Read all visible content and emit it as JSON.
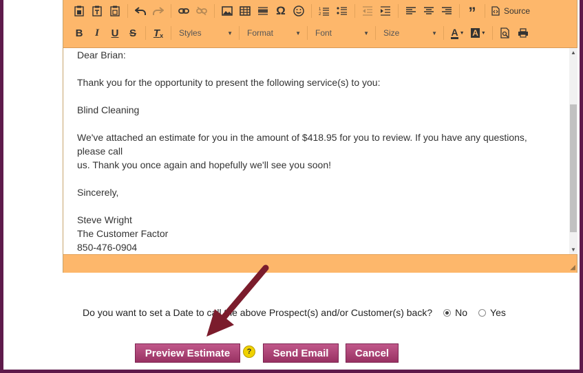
{
  "toolbar": {
    "source_label": "Source",
    "styles_label": "Styles",
    "format_label": "Format",
    "font_label": "Font",
    "size_label": "Size"
  },
  "editor_body": {
    "lines": [
      "Dear Brian:",
      "",
      "Thank you for the opportunity to present the following service(s) to you:",
      "",
      "Blind Cleaning",
      "",
      "We've attached an estimate for you in the amount of $418.95 for you to review. If you have any questions, please call",
      "us. Thank you once again and hopefully we'll see you soon!",
      "",
      "Sincerely,",
      "",
      "Steve Wright",
      "The Customer Factor",
      "850-476-0904"
    ]
  },
  "callback": {
    "question": "Do you want to set a Date to call the above Prospect(s) and/or Customer(s) back?",
    "options": [
      "No",
      "Yes"
    ],
    "selected": "No"
  },
  "actions": {
    "preview_label": "Preview Estimate",
    "send_label": "Send Email",
    "cancel_label": "Cancel",
    "help_glyph": "?"
  },
  "icons": {
    "paste": "paste-icon",
    "paste_text": "paste-as-text-icon",
    "paste_word": "paste-from-word-icon",
    "undo": "undo-icon",
    "redo": "redo-icon",
    "link": "link-icon",
    "unlink": "unlink-icon",
    "image": "image-icon",
    "table": "table-icon",
    "hr": "horizontal-rule-icon",
    "special_char": "omega-icon",
    "smiley": "smiley-icon",
    "ol": "numbered-list-icon",
    "ul": "bulleted-list-icon",
    "outdent": "outdent-icon",
    "indent": "indent-icon",
    "align_left": "align-left-icon",
    "align_center": "align-center-icon",
    "align_right": "align-right-icon",
    "blockquote": "blockquote-icon",
    "source": "source-icon",
    "bold": "bold-icon",
    "italic": "italic-icon",
    "underline": "underline-icon",
    "strike": "strikethrough-icon",
    "remove_format": "remove-format-icon",
    "text_color": "text-color-icon",
    "bg_color": "background-color-icon",
    "preview": "preview-icon",
    "print": "print-icon"
  },
  "colors": {
    "toolbar_bg": "#fdb76b",
    "button_gradient_top": "#c0588a",
    "button_gradient_bottom": "#993263",
    "frame": "#5e1a4b",
    "arrow": "#7b1c2c"
  }
}
